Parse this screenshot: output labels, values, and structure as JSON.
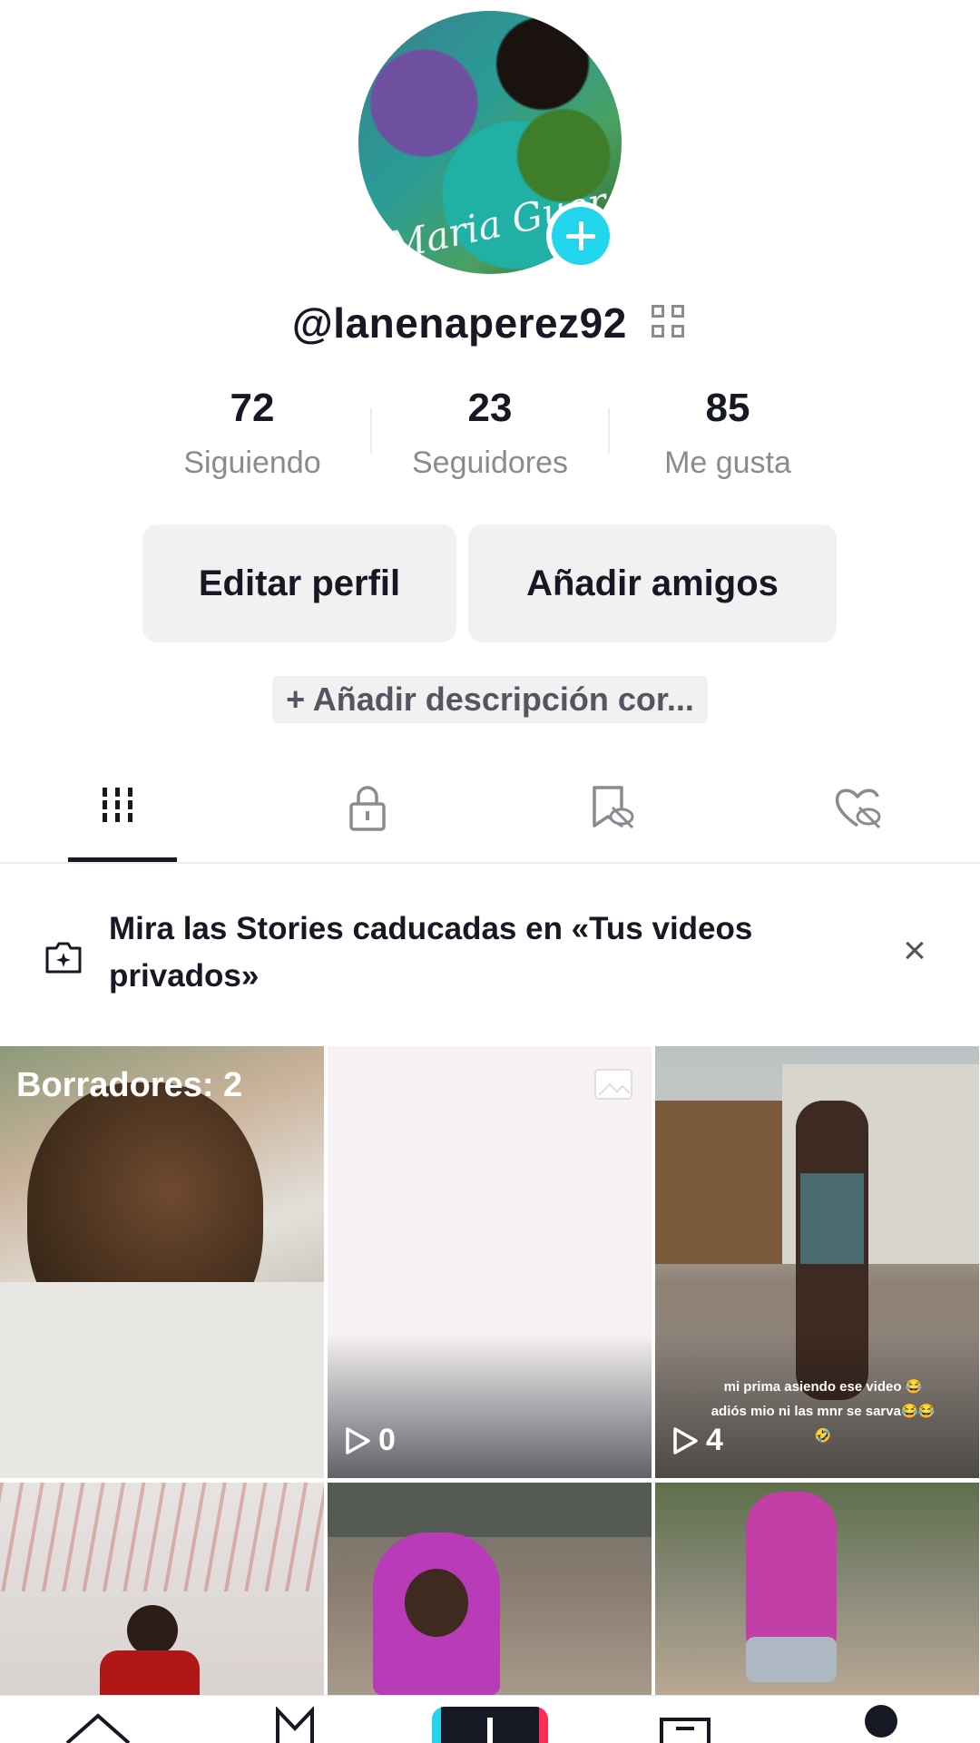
{
  "profile": {
    "username": "@lanenaperez92",
    "avatar_signature": "Maria Guer",
    "stats": [
      {
        "value": "72",
        "label": "Siguiendo"
      },
      {
        "value": "23",
        "label": "Seguidores"
      },
      {
        "value": "85",
        "label": "Me gusta"
      }
    ],
    "edit_button": "Editar perfil",
    "add_friends_button": "Añadir amigos",
    "add_bio": "+ Añadir descripción cor..."
  },
  "tabs": [
    {
      "icon": "grid-icon",
      "active": true
    },
    {
      "icon": "lock-icon",
      "active": false
    },
    {
      "icon": "hidden-bookmark-icon",
      "active": false
    },
    {
      "icon": "hidden-heart-icon",
      "active": false
    }
  ],
  "banner": {
    "icon": "camera-sparkle-icon",
    "text": "Mira las Stories caducadas en «Tus videos privados»",
    "close": "×"
  },
  "videos": [
    {
      "overlay_label": "Borradores: 2"
    },
    {
      "views": "0"
    },
    {
      "views": "4",
      "caption": "mi prima asiendo ese video 😂 adiós mio ni las mnr se sarva😂😂 🤣"
    },
    {},
    {},
    {}
  ],
  "colors": {
    "accent": "#20d5ec",
    "text": "#161823",
    "muted": "#8a8b91"
  }
}
